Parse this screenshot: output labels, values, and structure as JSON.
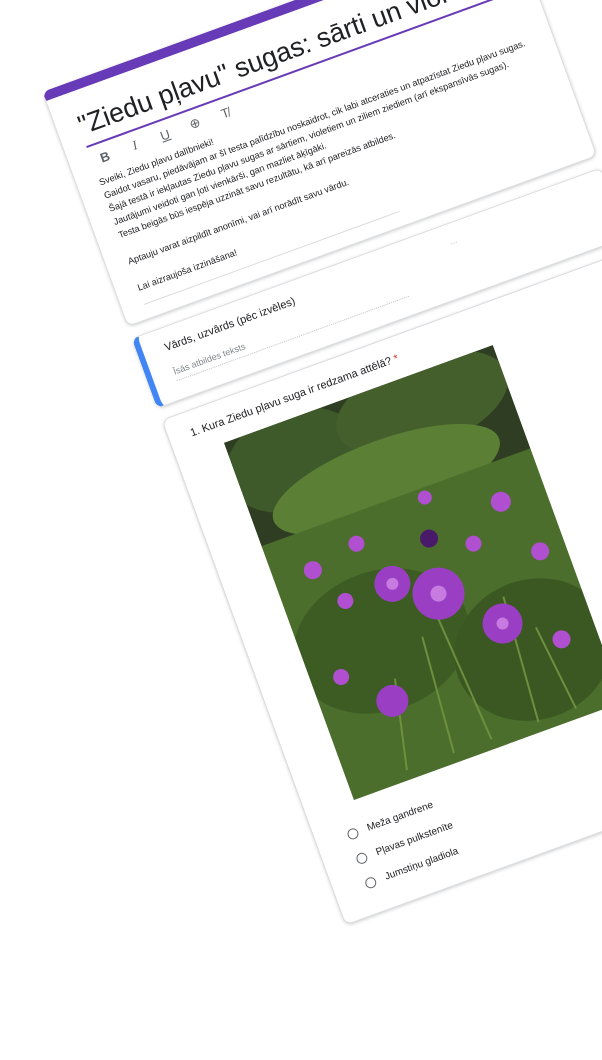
{
  "form": {
    "title": "\"Ziedu pļavu\" sugas: sārti un violeti ziedi",
    "toolbar": {
      "bold": "B",
      "italic": "I",
      "underline": "U",
      "link": "⊕",
      "clear": "T̸"
    },
    "description": [
      "Sveiki, Ziedu pļavu dalībnieki!",
      "Gaidot vasaru, piedāvājam ar šī testa palīdzību noskaidrot, cik labi atceraties un atpazīstat Ziedu pļavu sugas.",
      "Šajā testā ir iekļautas Ziedu pļavu sugas ar sārtiem, violetiem un ziliem ziediem (arī ekspansīvās sugas).",
      "Jautājumi veidoti gan ļoti vienkārši, gan mazliet āķīgāki.",
      "Testa beigās būs iespēja uzzināt savu rezultātu, kā arī pareizās atbildes.",
      "",
      "Aptauju varat aizpildīt anonīmi, vai arī norādīt savu vārdu.",
      "",
      "Lai aizraujoša izzināšana!"
    ]
  },
  "name_question": {
    "title": "Vārds, uzvārds (pēc izvēles)",
    "placeholder": "Īsās atbildes teksts"
  },
  "question1": {
    "title": "1. Kura Ziedu pļavu suga ir redzama attēlā?",
    "required_mark": "*",
    "options": [
      "Meža gandrene",
      "Pļavas pulkstenīte",
      "Jumstiņu gladiola"
    ]
  },
  "colors": {
    "accent": "#673ab7",
    "focus": "#4285f4",
    "required": "#d93025"
  }
}
